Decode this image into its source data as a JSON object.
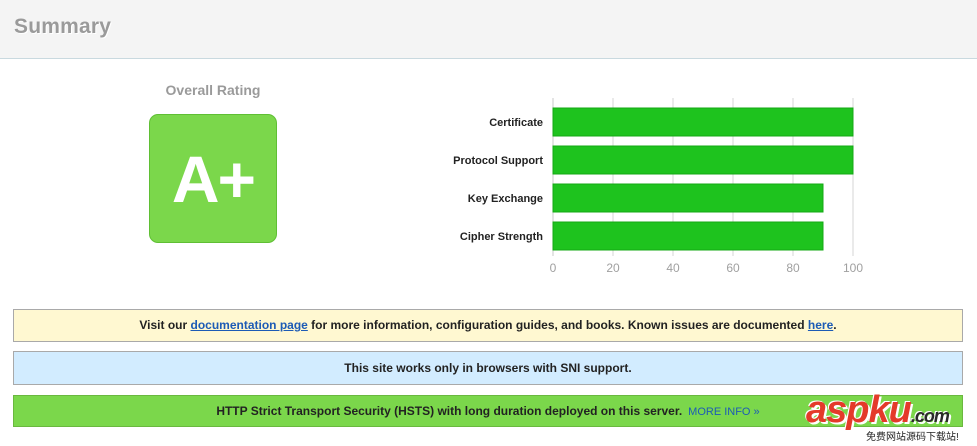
{
  "header": {
    "title": "Summary"
  },
  "rating": {
    "title": "Overall Rating",
    "grade": "A+"
  },
  "chart_data": {
    "type": "bar",
    "orientation": "horizontal",
    "categories": [
      "Certificate",
      "Protocol Support",
      "Key Exchange",
      "Cipher Strength"
    ],
    "values": [
      100,
      100,
      90,
      90
    ],
    "xlim": [
      0,
      100
    ],
    "ticks": [
      "0",
      "20",
      "40",
      "60",
      "80",
      "100"
    ],
    "grid": true,
    "bar_color": "#1ec31e"
  },
  "notices": {
    "docs": {
      "text_before": "Visit our ",
      "link1": "documentation page",
      "text_middle": " for more information, configuration guides, and books. Known issues are documented ",
      "link2": "here",
      "text_after": "."
    },
    "sni": {
      "text": "This site works only in browsers with SNI support."
    },
    "hsts": {
      "text": "HTTP Strict Transport Security (HSTS) with long duration deployed on this server.",
      "link": "MORE INFO »"
    }
  },
  "watermark": {
    "main": "aspku",
    "dot_com": ".com",
    "sub": "免费网站源码下载站!"
  }
}
